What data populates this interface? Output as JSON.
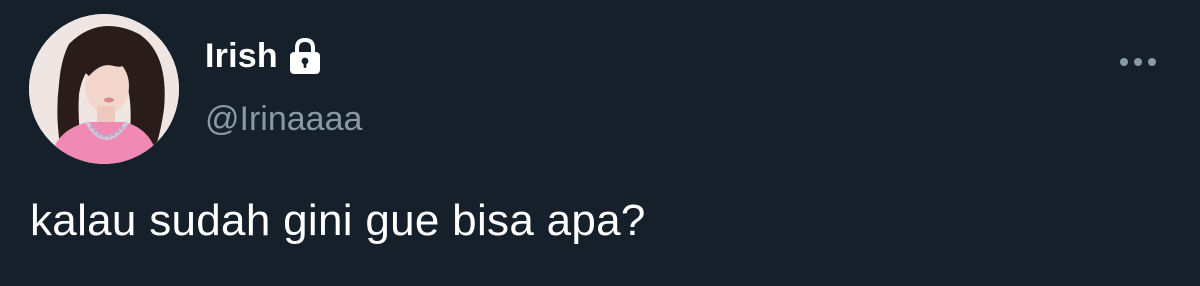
{
  "author": {
    "display_name": "Irish",
    "handle": "@Irinaaaa",
    "protected_icon": "lock-icon",
    "avatar_icon": "avatar-photo"
  },
  "tweet": {
    "text": "kalau sudah gini gue bisa apa?"
  },
  "menu": {
    "icon": "more-horizontal-icon"
  },
  "colors": {
    "background": "#15202b",
    "primary_text": "#ffffff",
    "secondary_text": "#8899a6"
  }
}
